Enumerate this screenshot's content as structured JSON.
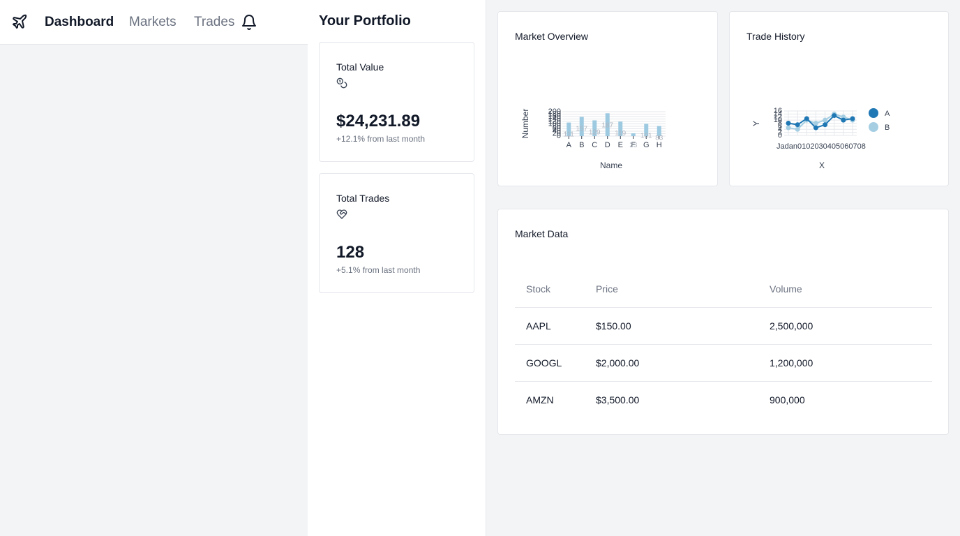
{
  "nav": {
    "logo_icon": "plane-icon",
    "items": [
      {
        "label": "Dashboard"
      },
      {
        "label": "Markets"
      },
      {
        "label": "Trades"
      }
    ],
    "bell_icon": "bell-icon"
  },
  "portfolio": {
    "title": "Your Portfolio",
    "cards": [
      {
        "label": "Total Value",
        "icon": "coins-icon",
        "value": "$24,231.89",
        "change": "+12.1% from last month"
      },
      {
        "label": "Total Trades",
        "icon": "heart-handshake-icon",
        "value": "128",
        "change": "+5.1% from last month"
      }
    ]
  },
  "overview": {
    "title": "Market Overview",
    "chart_data": {
      "type": "bar",
      "categories": [
        "A",
        "B",
        "C",
        "D",
        "E",
        "F",
        "G",
        "H"
      ],
      "values": [
        111,
        157,
        129,
        187,
        119,
        23,
        101,
        83
      ],
      "xlabel": "Name",
      "ylabel": "Number",
      "yticks": [
        "0",
        "20",
        "40",
        "60",
        "80",
        "100",
        "120",
        "140",
        "160",
        "180",
        "200"
      ],
      "ylim": [
        0,
        200
      ],
      "color": "#9ecae1",
      "grid": true
    }
  },
  "history": {
    "title": "Trade History",
    "chart_data": {
      "type": "line",
      "x": [
        "Jan",
        "01",
        "02",
        "03",
        "04",
        "05",
        "06",
        "07",
        "08"
      ],
      "xticks_label": "Jadan0102030405060708",
      "xlabel": "X",
      "ylabel": "Y",
      "yticks": [
        "0",
        "2",
        "4",
        "6",
        "8",
        "10",
        "12",
        "14",
        "16"
      ],
      "ylim": [
        0,
        16
      ],
      "series": [
        {
          "name": "A",
          "values": [
            8,
            7,
            11,
            5,
            7,
            13,
            10,
            11
          ],
          "color": "#1f77b4"
        },
        {
          "name": "B",
          "values": [
            5,
            4,
            10,
            8,
            10,
            14,
            12,
            10
          ],
          "color": "#a6cee3"
        }
      ],
      "legend": "right",
      "grid": true
    }
  },
  "market": {
    "title": "Market Data",
    "columns": [
      "Stock",
      "Price",
      "Volume"
    ],
    "rows": [
      [
        "AAPL",
        "$150.00",
        "2,500,000"
      ],
      [
        "GOOGL",
        "$2,000.00",
        "1,200,000"
      ],
      [
        "AMZN",
        "$3,500.00",
        "900,000"
      ]
    ]
  }
}
